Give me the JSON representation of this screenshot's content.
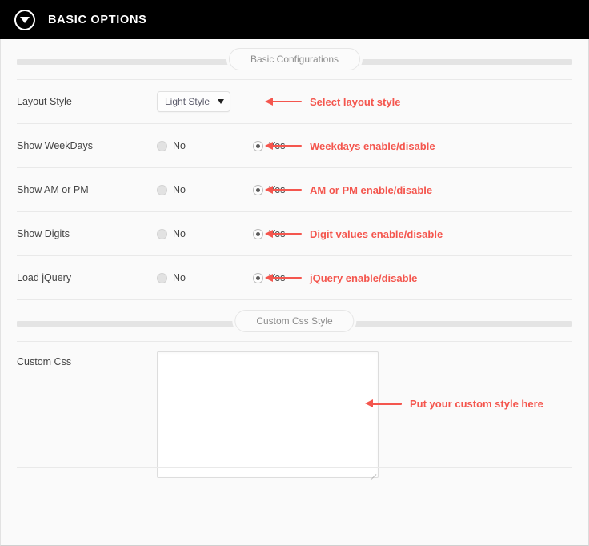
{
  "titlebar": {
    "title": "BASIC OPTIONS",
    "toggle_icon": "chevron-down-circle-icon"
  },
  "sections": [
    {
      "id": "basic",
      "pill_label": "Basic Configurations"
    },
    {
      "id": "customcss",
      "pill_label": "Custom Css Style"
    }
  ],
  "accent_color": "#f4564e",
  "fields": {
    "layout_style": {
      "label": "Layout Style",
      "selected": "Light Style",
      "options": [
        "Light Style"
      ],
      "annotation": "Select layout style"
    },
    "show_weekdays": {
      "label": "Show WeekDays",
      "no_label": "No",
      "yes_label": "Yes",
      "value": "Yes",
      "annotation": "Weekdays enable/disable"
    },
    "show_am_pm": {
      "label": "Show AM or PM",
      "no_label": "No",
      "yes_label": "Yes",
      "value": "Yes",
      "annotation": "AM or PM enable/disable"
    },
    "show_digits": {
      "label": "Show Digits",
      "no_label": "No",
      "yes_label": "Yes",
      "value": "Yes",
      "annotation": "Digit values enable/disable"
    },
    "load_jquery": {
      "label": "Load jQuery",
      "no_label": "No",
      "yes_label": "Yes",
      "value": "Yes",
      "annotation": "jQuery enable/disable"
    },
    "custom_css": {
      "label": "Custom Css",
      "value": "",
      "placeholder": "",
      "annotation": "Put your custom style here"
    }
  }
}
